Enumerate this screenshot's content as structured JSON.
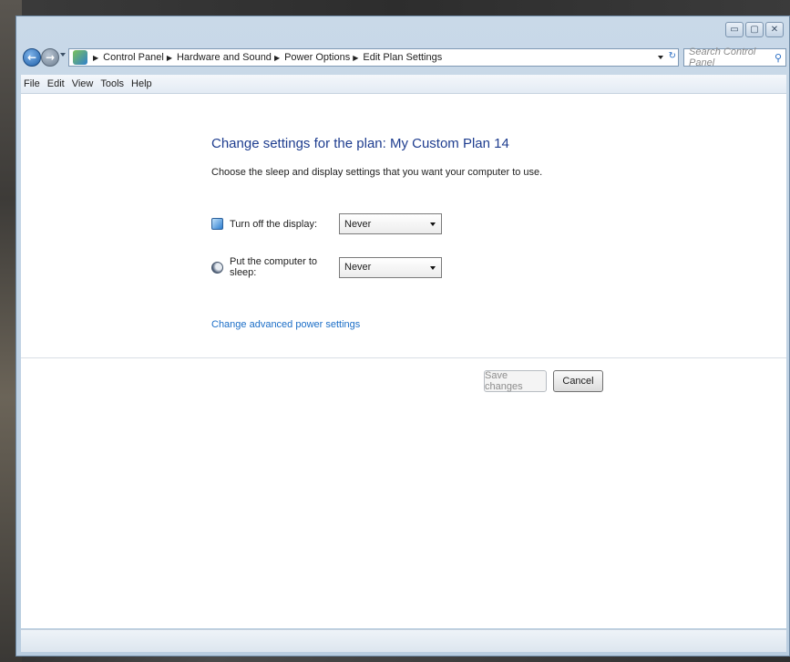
{
  "window": {
    "caption_buttons": {
      "minimize": "▭",
      "maximize": "▢",
      "close": "✕"
    }
  },
  "address_bar": {
    "breadcrumbs": [
      "Control Panel",
      "Hardware and Sound",
      "Power Options",
      "Edit Plan Settings"
    ],
    "search_placeholder": "Search Control Panel"
  },
  "menu": [
    "File",
    "Edit",
    "View",
    "Tools",
    "Help"
  ],
  "content": {
    "title": "Change settings for the plan: My Custom Plan 14",
    "description": "Choose the sleep and display settings that you want your computer to use.",
    "settings": [
      {
        "label": "Turn off the display:",
        "value": "Never",
        "icon": "display-icon"
      },
      {
        "label": "Put the computer to sleep:",
        "value": "Never",
        "icon": "sleep-icon"
      }
    ],
    "advanced_link": "Change advanced power settings",
    "save_label": "Save changes",
    "cancel_label": "Cancel"
  },
  "colors": {
    "title": "#1e3d8f",
    "link": "#1b6ec7",
    "frame": "#c9d9e8"
  }
}
